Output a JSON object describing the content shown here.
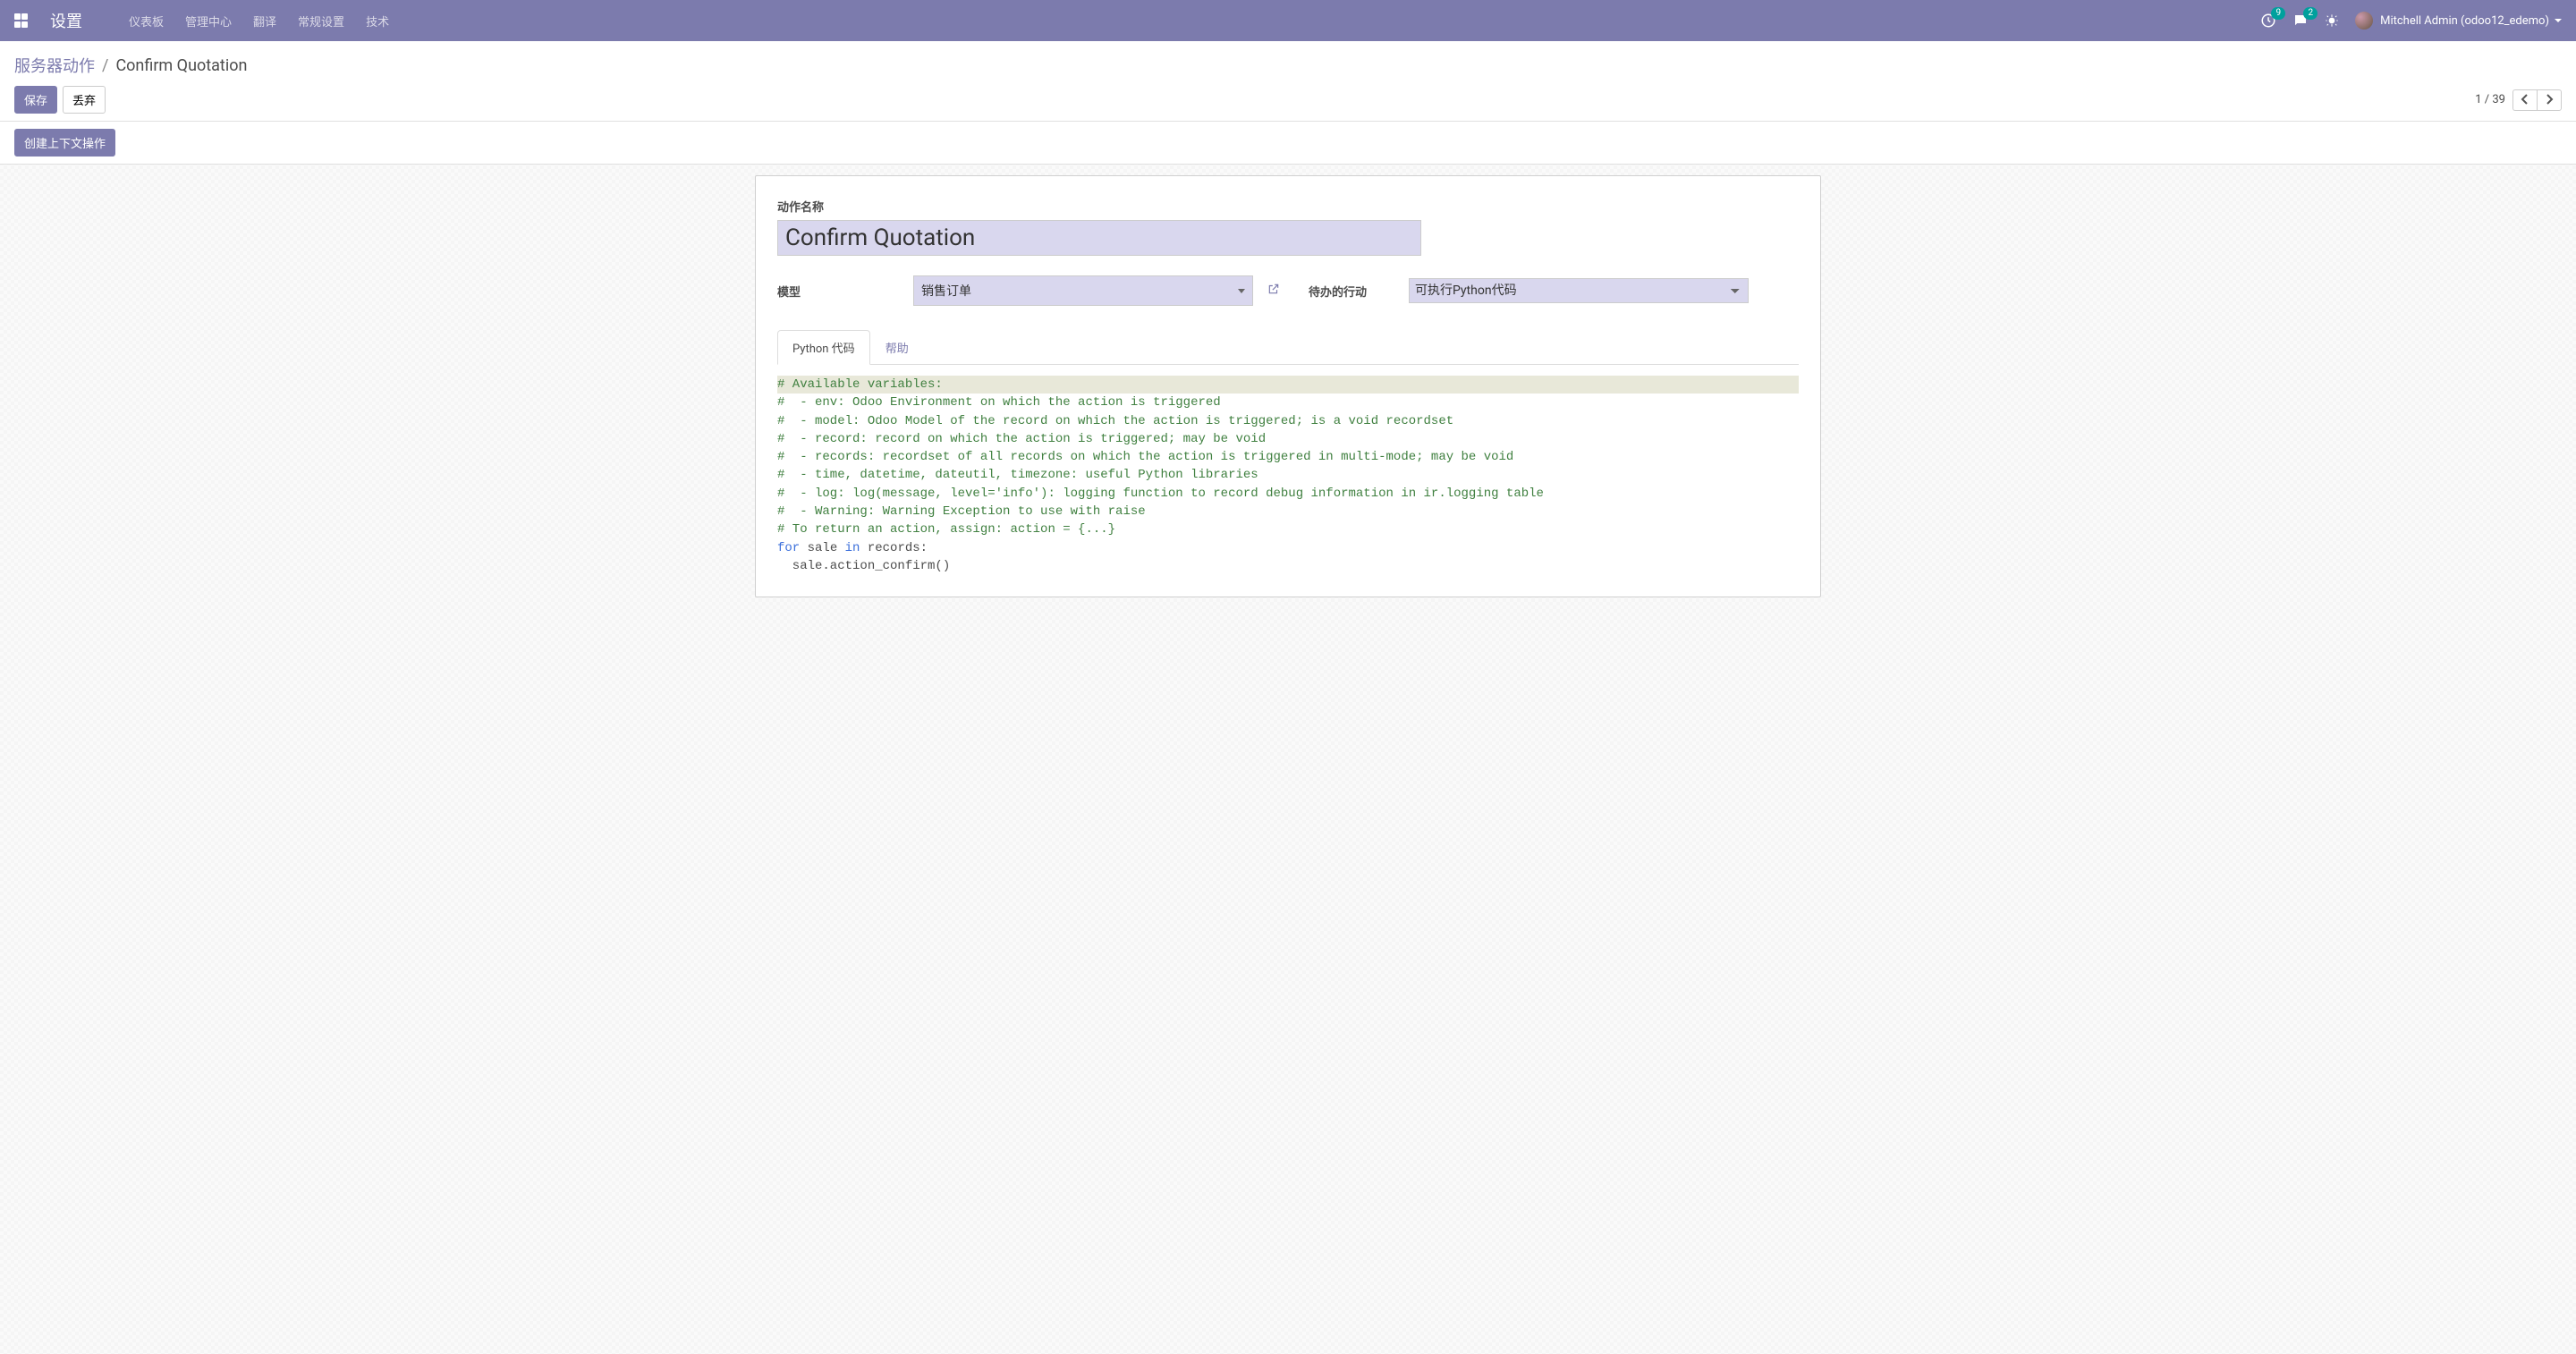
{
  "navbar": {
    "brand": "设置",
    "menu": [
      "仪表板",
      "管理中心",
      "翻译",
      "常规设置",
      "技术"
    ],
    "activities_count": "9",
    "messages_count": "2",
    "user": "Mitchell Admin (odoo12_edemo)"
  },
  "breadcrumb": {
    "parent": "服务器动作",
    "current": "Confirm Quotation"
  },
  "buttons": {
    "save": "保存",
    "discard": "丢弃",
    "create_context_action": "创建上下文操作"
  },
  "pager": {
    "current": "1",
    "sep": "/",
    "total": "39"
  },
  "form": {
    "name_label": "动作名称",
    "name_value": "Confirm Quotation",
    "model_label": "模型",
    "model_value": "销售订单",
    "action_label": "待办的行动",
    "action_value": "可执行Python代码"
  },
  "tabs": {
    "python": "Python 代码",
    "help": "帮助"
  },
  "code": {
    "l1": "# Available variables:",
    "l2": "#  - env: Odoo Environment on which the action is triggered",
    "l3": "#  - model: Odoo Model of the record on which the action is triggered; is a void recordset",
    "l4": "#  - record: record on which the action is triggered; may be void",
    "l5": "#  - records: recordset of all records on which the action is triggered in multi-mode; may be void",
    "l6": "#  - time, datetime, dateutil, timezone: useful Python libraries",
    "l7": "#  - log: log(message, level='info'): logging function to record debug information in ir.logging table",
    "l8": "#  - Warning: Warning Exception to use with raise",
    "l9": "# To return an action, assign: action = {...}",
    "kw_for": "for",
    "p1": " sale ",
    "kw_in": "in",
    "p2": " records:",
    "l11": "  sale.action_confirm()"
  }
}
